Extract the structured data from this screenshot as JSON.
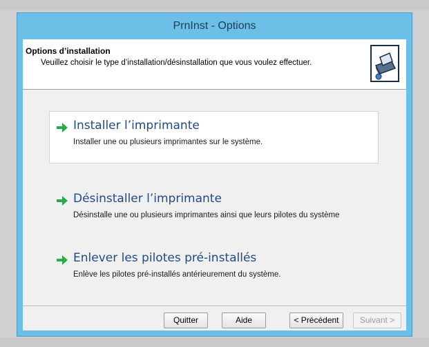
{
  "window": {
    "title": "PrnInst - Options"
  },
  "header": {
    "title": "Options d’installation",
    "subtitle": "Veuillez choisir le type d’installation/désinstallation que vous voulez effectuer.",
    "icon": "printer-setup-icon"
  },
  "options": [
    {
      "title": "Installer l’imprimante",
      "description": "Installer une ou plusieurs imprimantes sur le système.",
      "icon": "green-arrow-icon"
    },
    {
      "title": "Désinstaller l’imprimante",
      "description": "Désinstalle une ou plusieurs imprimantes ainsi que leurs pilotes du système",
      "icon": "green-arrow-icon"
    },
    {
      "title": "Enlever les pilotes pré-installés",
      "description": "Enlève les pilotes pré-installés antérieurement du système.",
      "icon": "green-arrow-icon"
    }
  ],
  "buttons": {
    "quit": "Quitter",
    "help": "Aide",
    "previous": "< Précédent",
    "next": "Suivant >"
  },
  "colors": {
    "title_bar": "#6cc0e7",
    "option_title": "#1f4a85",
    "arrow": "#2da84a"
  }
}
